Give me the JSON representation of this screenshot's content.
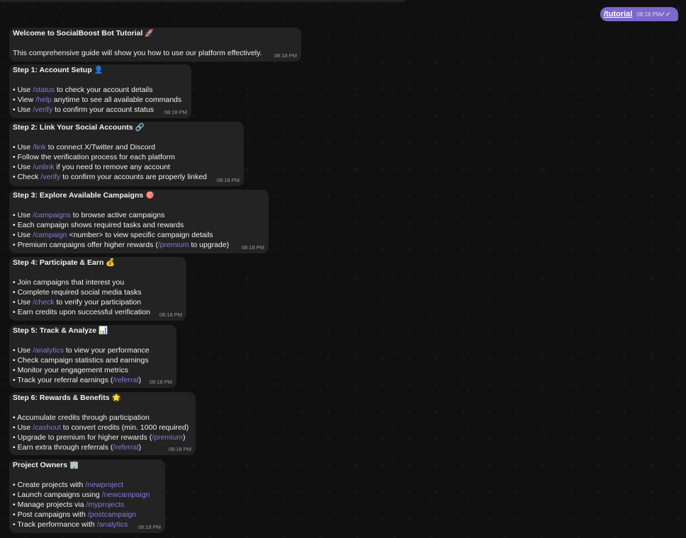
{
  "outgoing": {
    "command": "/tutorial",
    "time": "08:18 PM",
    "check": "✓✓"
  },
  "bubbles": [
    {
      "title": "Welcome to SocialBoost Bot Tutorial 🚀",
      "time": "08:18 PM",
      "lines": [
        [
          {
            "t": "This comprehensive guide will show you how to use our platform effectively."
          }
        ]
      ]
    },
    {
      "title": "Step 1: Account Setup 👤",
      "time": "08:18 PM",
      "lines": [
        [
          {
            "t": "• Use "
          },
          {
            "t": "/status",
            "c": 1
          },
          {
            "t": " to check your account details"
          }
        ],
        [
          {
            "t": "• View "
          },
          {
            "t": "/help",
            "c": 1
          },
          {
            "t": " anytime to see all available commands"
          }
        ],
        [
          {
            "t": "• Use "
          },
          {
            "t": "/verify",
            "c": 1
          },
          {
            "t": " to confirm your account status"
          }
        ]
      ]
    },
    {
      "title": "Step 2: Link Your Social Accounts 🔗",
      "time": "08:18 PM",
      "lines": [
        [
          {
            "t": "• Use "
          },
          {
            "t": "/link",
            "c": 1
          },
          {
            "t": " to connect X/Twitter and Discord"
          }
        ],
        [
          {
            "t": "• Follow the verification process for each platform"
          }
        ],
        [
          {
            "t": "• Use "
          },
          {
            "t": "/unlink",
            "c": 1
          },
          {
            "t": " if you need to remove any account"
          }
        ],
        [
          {
            "t": "• Check "
          },
          {
            "t": "/verify",
            "c": 1
          },
          {
            "t": " to confirm your accounts are properly linked"
          }
        ]
      ]
    },
    {
      "title": "Step 3: Explore Available Campaigns 🎯",
      "time": "08:18 PM",
      "lines": [
        [
          {
            "t": "• Use "
          },
          {
            "t": "/campaigns",
            "c": 1
          },
          {
            "t": " to browse active campaigns"
          }
        ],
        [
          {
            "t": "• Each campaign shows required tasks and rewards"
          }
        ],
        [
          {
            "t": "• Use "
          },
          {
            "t": "/campaign",
            "c": 1
          },
          {
            "t": " <number> to view specific campaign details"
          }
        ],
        [
          {
            "t": "• Premium campaigns offer higher rewards ("
          },
          {
            "t": "/premium",
            "c": 1
          },
          {
            "t": " to upgrade)"
          }
        ]
      ]
    },
    {
      "title": "Step 4: Participate & Earn 💰",
      "time": "08:18 PM",
      "lines": [
        [
          {
            "t": "• Join campaigns that interest you"
          }
        ],
        [
          {
            "t": "• Complete required social media tasks"
          }
        ],
        [
          {
            "t": "• Use "
          },
          {
            "t": "/check",
            "c": 1
          },
          {
            "t": " to verify your participation"
          }
        ],
        [
          {
            "t": "• Earn credits upon successful verification"
          }
        ]
      ]
    },
    {
      "title": "Step 5: Track & Analyze 📊",
      "time": "08:18 PM",
      "lines": [
        [
          {
            "t": "• Use "
          },
          {
            "t": "/analytics",
            "c": 1
          },
          {
            "t": " to view your performance"
          }
        ],
        [
          {
            "t": "• Check campaign statistics and earnings"
          }
        ],
        [
          {
            "t": "• Monitor your engagement metrics"
          }
        ],
        [
          {
            "t": "• Track your referral earnings ("
          },
          {
            "t": "/referral",
            "c": 1
          },
          {
            "t": ")"
          }
        ]
      ]
    },
    {
      "title": "Step 6: Rewards & Benefits 🌟",
      "time": "08:18 PM",
      "lines": [
        [
          {
            "t": "• Accumulate credits through participation"
          }
        ],
        [
          {
            "t": "• Use "
          },
          {
            "t": "/cashout",
            "c": 1
          },
          {
            "t": " to convert credits (min. 1000 required)"
          }
        ],
        [
          {
            "t": "• Upgrade to premium for higher rewards ("
          },
          {
            "t": "/premium",
            "c": 1
          },
          {
            "t": ")"
          }
        ],
        [
          {
            "t": "• Earn extra through referrals ("
          },
          {
            "t": "/referral",
            "c": 1
          },
          {
            "t": ")"
          }
        ]
      ]
    },
    {
      "title": "Project Owners 🏢",
      "time": "08:18 PM",
      "lines": [
        [
          {
            "t": "• Create projects with "
          },
          {
            "t": "/newproject",
            "c": 1
          }
        ],
        [
          {
            "t": "• Launch campaigns using "
          },
          {
            "t": "/newcampaign",
            "c": 1
          }
        ],
        [
          {
            "t": "• Manage projects via "
          },
          {
            "t": "/myprojects",
            "c": 1
          }
        ],
        [
          {
            "t": "• Post campaigns with "
          },
          {
            "t": "/postcampaign",
            "c": 1
          }
        ],
        [
          {
            "t": "• Track performance with "
          },
          {
            "t": "/analytics",
            "c": 1
          }
        ]
      ]
    }
  ]
}
